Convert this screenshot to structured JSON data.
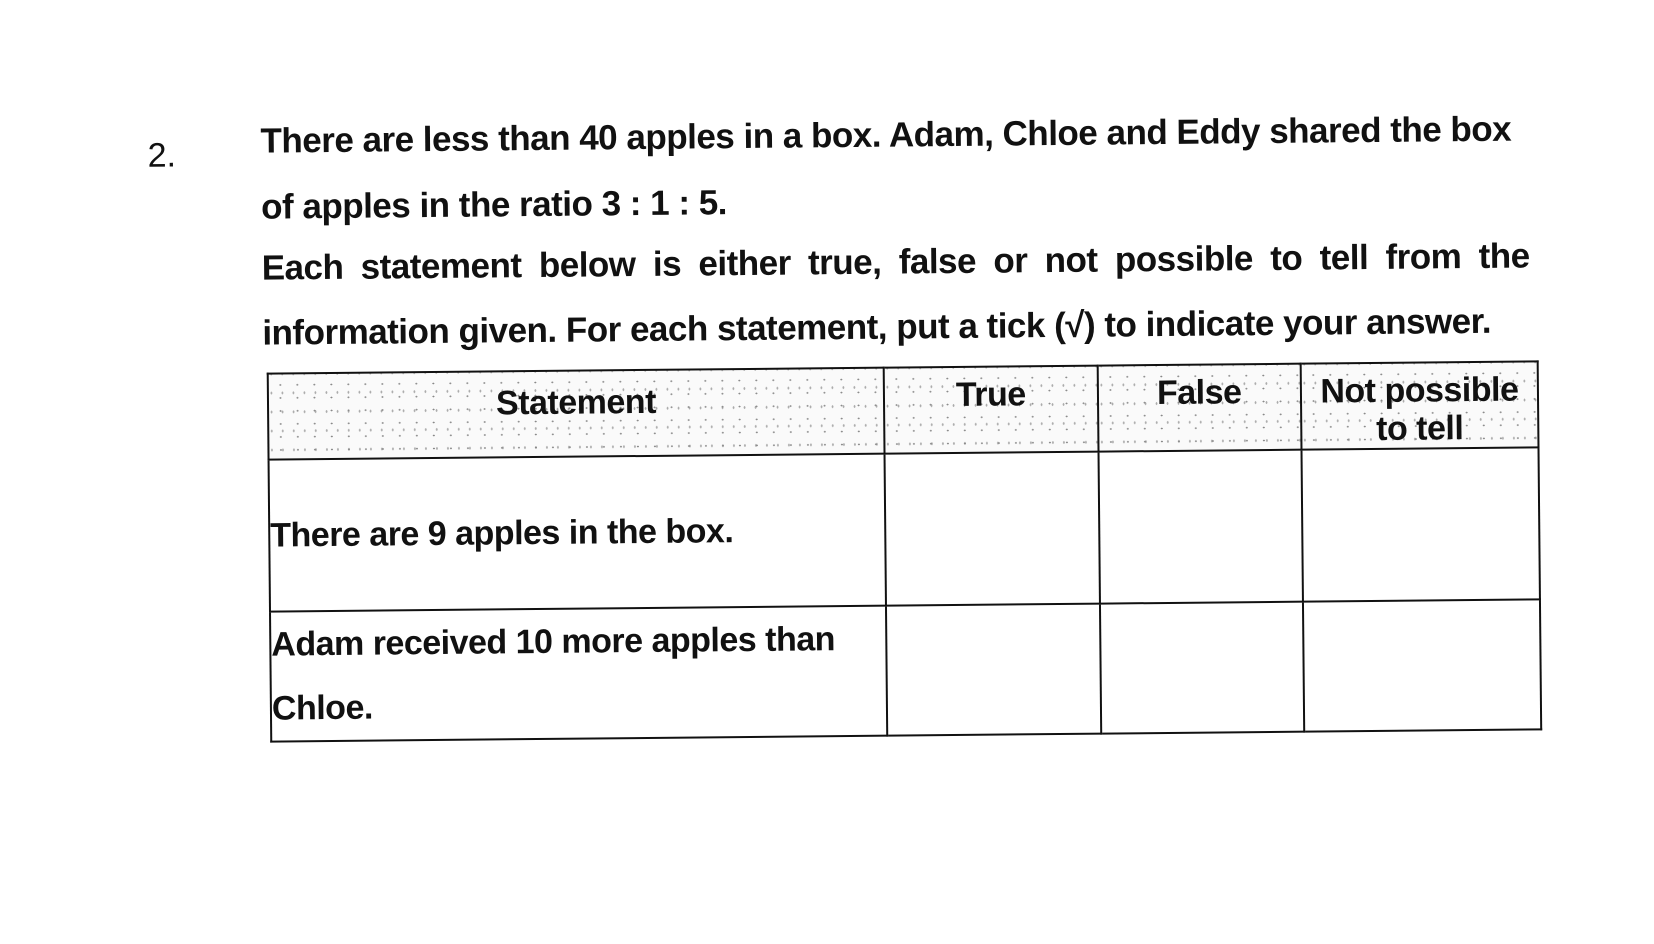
{
  "question": {
    "number": "2.",
    "lines": [
      "There are less than 40 apples in a box. Adam, Chloe and Eddy shared the box",
      "of apples in the ratio 3 : 1 : 5.",
      "Each statement below is either true, false or not possible to tell from the",
      "information given. For each statement, put a tick (√) to indicate your answer."
    ]
  },
  "table": {
    "headers": [
      "Statement",
      "True",
      "False",
      "Not possible to tell"
    ],
    "rows": [
      {
        "statement": "There are 9 apples in the box."
      },
      {
        "statement": "Adam received 10 more apples than Chloe."
      }
    ]
  }
}
